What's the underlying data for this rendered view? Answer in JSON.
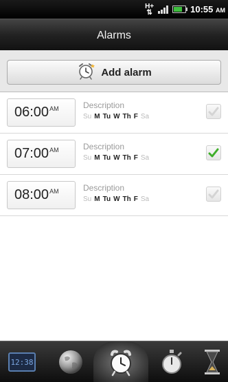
{
  "status_bar": {
    "network": "H+",
    "time": "10:55",
    "ampm": "AM"
  },
  "title": "Alarms",
  "add_alarm": {
    "label": "Add alarm"
  },
  "alarms": [
    {
      "time": "06:00",
      "ampm": "AM",
      "description": "Description",
      "days": [
        {
          "label": "Su",
          "active": false
        },
        {
          "label": "M",
          "active": true
        },
        {
          "label": "Tu",
          "active": true
        },
        {
          "label": "W",
          "active": true
        },
        {
          "label": "Th",
          "active": true
        },
        {
          "label": "F",
          "active": true
        },
        {
          "label": "Sa",
          "active": false
        }
      ],
      "enabled": false
    },
    {
      "time": "07:00",
      "ampm": "AM",
      "description": "Description",
      "days": [
        {
          "label": "Su",
          "active": false
        },
        {
          "label": "M",
          "active": true
        },
        {
          "label": "Tu",
          "active": true
        },
        {
          "label": "W",
          "active": true
        },
        {
          "label": "Th",
          "active": true
        },
        {
          "label": "F",
          "active": true
        },
        {
          "label": "Sa",
          "active": false
        }
      ],
      "enabled": true
    },
    {
      "time": "08:00",
      "ampm": "AM",
      "description": "Description",
      "days": [
        {
          "label": "Su",
          "active": false
        },
        {
          "label": "M",
          "active": true
        },
        {
          "label": "Tu",
          "active": true
        },
        {
          "label": "W",
          "active": true
        },
        {
          "label": "Th",
          "active": true
        },
        {
          "label": "F",
          "active": true
        },
        {
          "label": "Sa",
          "active": false
        }
      ],
      "enabled": false
    }
  ],
  "tabs": [
    {
      "name": "clock-tab",
      "icon": "digital-clock-icon",
      "active": false,
      "clock_text": "12:38"
    },
    {
      "name": "world-clock-tab",
      "icon": "globe-icon",
      "active": false
    },
    {
      "name": "alarms-tab",
      "icon": "alarm-clock-icon",
      "active": true
    },
    {
      "name": "stopwatch-tab",
      "icon": "stopwatch-icon",
      "active": false
    },
    {
      "name": "timer-tab",
      "icon": "hourglass-icon",
      "active": false
    }
  ],
  "colors": {
    "check_green": "#3fae2a",
    "title_bar": "#222222"
  }
}
